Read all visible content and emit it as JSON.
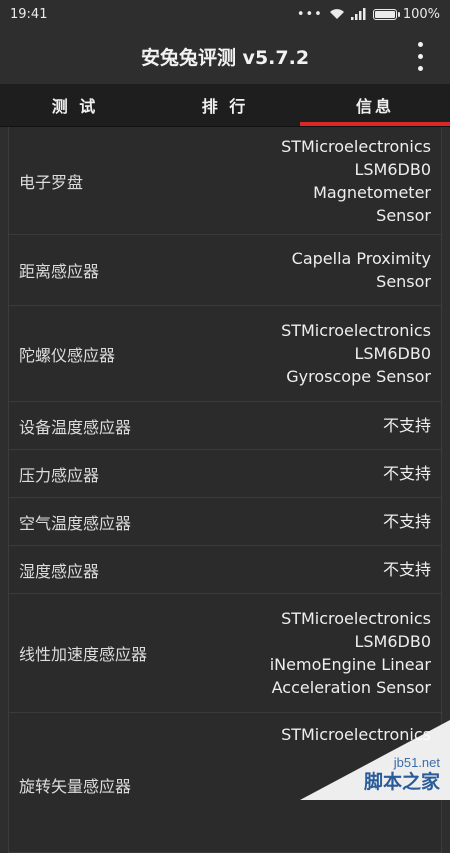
{
  "status": {
    "time": "19:41",
    "battery": "100%",
    "battery_level": 1.0
  },
  "appbar": {
    "title": "安兔兔评测 v5.7.2"
  },
  "tabs": [
    {
      "label": "测 试",
      "active": false
    },
    {
      "label": "排 行",
      "active": false
    },
    {
      "label": "信息",
      "active": true
    }
  ],
  "rows": [
    {
      "label": "电子罗盘",
      "value": "STMicroelectronics\nLSM6DB0\nMagnetometer\nSensor"
    },
    {
      "label": "距离感应器",
      "value": "Capella Proximity\nSensor"
    },
    {
      "label": "陀螺仪感应器",
      "value": "STMicroelectronics\nLSM6DB0\nGyroscope Sensor"
    },
    {
      "label": "设备温度感应器",
      "value": "不支持"
    },
    {
      "label": "压力感应器",
      "value": "不支持"
    },
    {
      "label": "空气温度感应器",
      "value": "不支持"
    },
    {
      "label": "湿度感应器",
      "value": "不支持"
    },
    {
      "label": "线性加速度感应器",
      "value": "STMicroelectronics\nLSM6DB0\niNemoEngine Linear\nAcceleration Sensor"
    },
    {
      "label": "旋转矢量感应器",
      "value": "STMicroelectronics\n\n"
    }
  ],
  "watermark": {
    "line1": "jb51.net",
    "line2": "脚本之家"
  },
  "accent_color": "#d8282a"
}
